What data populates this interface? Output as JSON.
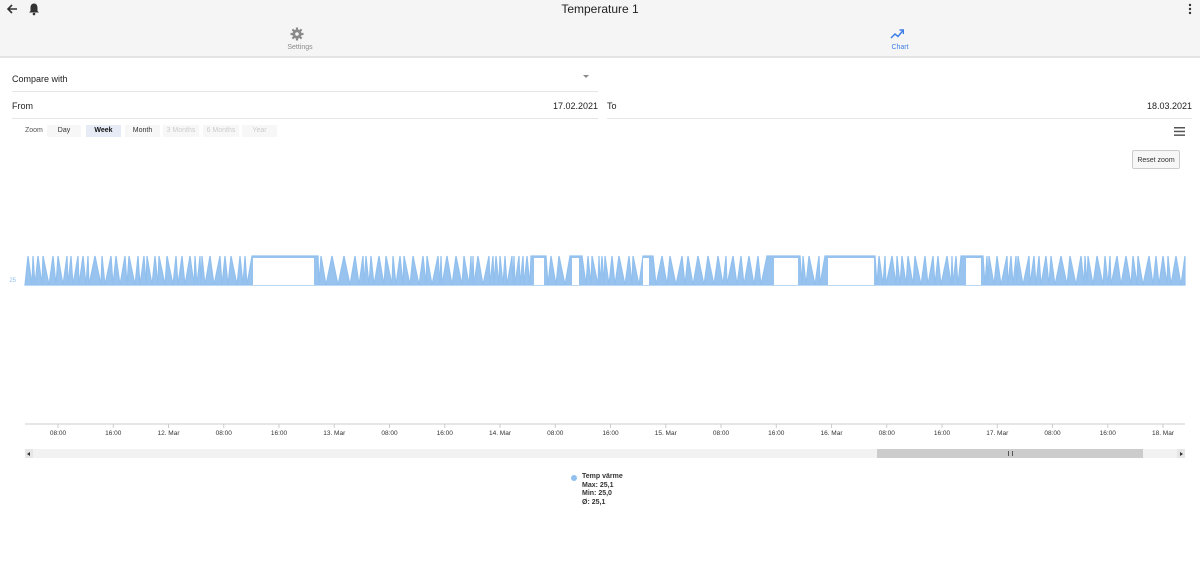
{
  "app_bar": {
    "title": "Temperature 1"
  },
  "tabs": [
    {
      "label": "Settings",
      "icon": "gear-icon"
    },
    {
      "label": "Chart",
      "icon": "trending-up-icon"
    }
  ],
  "form": {
    "compare_label": "Compare with",
    "from_label": "From",
    "from_value": "17.02.2021",
    "to_label": "To",
    "to_value": "18.03.2021"
  },
  "zoom": {
    "label": "Zoom",
    "options": [
      {
        "label": "Day",
        "state": "enabled"
      },
      {
        "label": "Week",
        "state": "active"
      },
      {
        "label": "Month",
        "state": "enabled"
      },
      {
        "label": "3 Months",
        "state": "disabled"
      },
      {
        "label": "6 Months",
        "state": "disabled"
      },
      {
        "label": "Year",
        "state": "disabled"
      }
    ]
  },
  "chart_toolbar": {
    "reset_zoom_label": "Reset zoom"
  },
  "colors": {
    "series": "#92c0ee",
    "accent": "#3d7ee6"
  },
  "chart_data": {
    "type": "area",
    "title": "",
    "xlabel": "",
    "ylabel": "",
    "y_tick_labels": [
      "25"
    ],
    "x_tick_labels": [
      "08:00",
      "16:00",
      "12. Mar",
      "08:00",
      "16:00",
      "13. Mar",
      "08:00",
      "16:00",
      "14. Mar",
      "08:00",
      "16:00",
      "15. Mar",
      "08:00",
      "16:00",
      "16. Mar",
      "08:00",
      "16:00",
      "17. Mar",
      "08:00",
      "16:00",
      "18. Mar"
    ],
    "ylim": [
      24.9,
      25.2
    ],
    "grid": false,
    "series": [
      {
        "name": "Temp värme",
        "values": [
          25.0,
          25.1
        ],
        "note_pattern": "oscillates rapidly between 25,0 and 25,1 from 11. Mar to 18. Mar"
      }
    ],
    "legend": {
      "name": "Temp värme",
      "stats": [
        "Max: 25,1",
        "Min: 25,0",
        "Ø: 25,1"
      ],
      "placement": "bottom-center"
    },
    "navigator_range": "16. Mar – 18. Mar"
  }
}
